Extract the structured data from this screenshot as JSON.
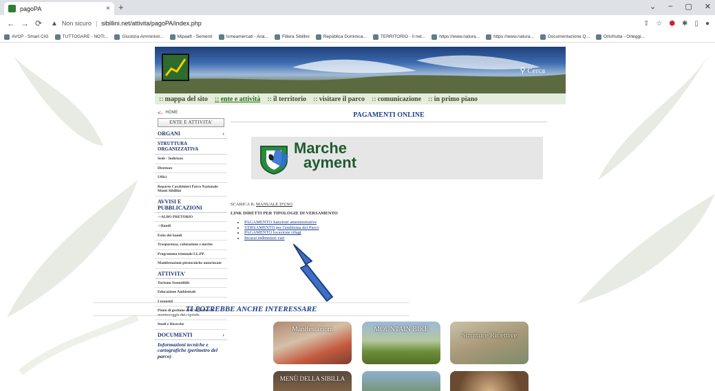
{
  "browser": {
    "tab_title": "pagoPA",
    "tab_close": "×",
    "new_tab": "+",
    "window_controls": [
      "⌄",
      "–",
      "▢",
      "✕"
    ],
    "security_label": "Non sicuro",
    "url_host": "sibillini.net",
    "url_path": "/attivita/pagoPA/index.php",
    "bookmarks": [
      "AVCP - Smart CIG",
      "TUTTOGARE - NOTI...",
      "Giustizia Amministr...",
      "Mipaaft - Sementi",
      "Ismeamercati - Ana...",
      "Filiera Sibillini",
      "República Dominica...",
      "TERRITORIO - Il net...",
      "https://www.natura...",
      "https://www.natura...",
      "Documentazione Q...",
      "Ortofrutta - Orteggi..."
    ]
  },
  "site": {
    "search_label": "Cerca",
    "menu": [
      "mappa del sito",
      "ente e attività",
      "il territorio",
      "visitare il parco",
      "comunicazione",
      "in primo piano"
    ],
    "menu_active_index": 1,
    "sidebar": {
      "home": "HOME",
      "button": "ENTE E ATTIVITA'",
      "organi": "ORGANI",
      "struttura": "STRUTTURA ORGANIZZATIVA",
      "items1": [
        "Sede - Indirizzo",
        "Direttore",
        "Uffici",
        "Reparto Carabinieri Parco Nazionale Monti Sibillini"
      ],
      "avvisi": "AVVISI E PUBBLICAZIONI",
      "items2": [
        "->ALBO PRETORIO",
        "->Bandi",
        "Esito dei bandi",
        "Trasparenza, valutazione e merito",
        "Programma triennale LL.PP.",
        "Manifestazioni pirotecniche autorizzate"
      ],
      "attivita": "ATTIVITA'",
      "items3": [
        "Turismo Sostenibile",
        "Educazione Ambientale",
        "I progetti",
        "Piano di gestione del Cinghiale e di monitoraggio del capriolo",
        "Studi e Ricerche"
      ],
      "documenti": "DOCUMENTI",
      "info": "Informazioni tecniche e cartografiche (perimetro del parco)"
    },
    "main": {
      "title": "PAGAMENTI ONLINE",
      "banner_line1": "Marche",
      "banner_line2": "ayment",
      "manuale_prefix": "SCARICA IL ",
      "manuale_link": "MANUALE D'USO",
      "link_heading": "LINK DIRETTI PER TIPOLOGIE DI VERSAMENTO",
      "links": [
        "PAGAMENTO Sanzioni amministrative",
        "VERSAMENTO per l'emblema del Parco",
        "PAGAMENTO locazione rifugi",
        "Incassi indennizzi vari"
      ],
      "potrebbe": "TI POTREBBE ANCHE INTERESSARE",
      "thumbs": [
        "Manifestazioni",
        "MOUNTAIN BIKE",
        "Strutture Ricettive",
        "MENÙ DELLA SIBILLA",
        "",
        ""
      ]
    },
    "colors": {
      "accent_blue": "#1b3f8b",
      "arrow_fill": "#3f6fc4",
      "arrow_stroke": "#1f3f80",
      "menu_bg": "#e4eddc",
      "banner_green": "#1f5b2e"
    }
  }
}
